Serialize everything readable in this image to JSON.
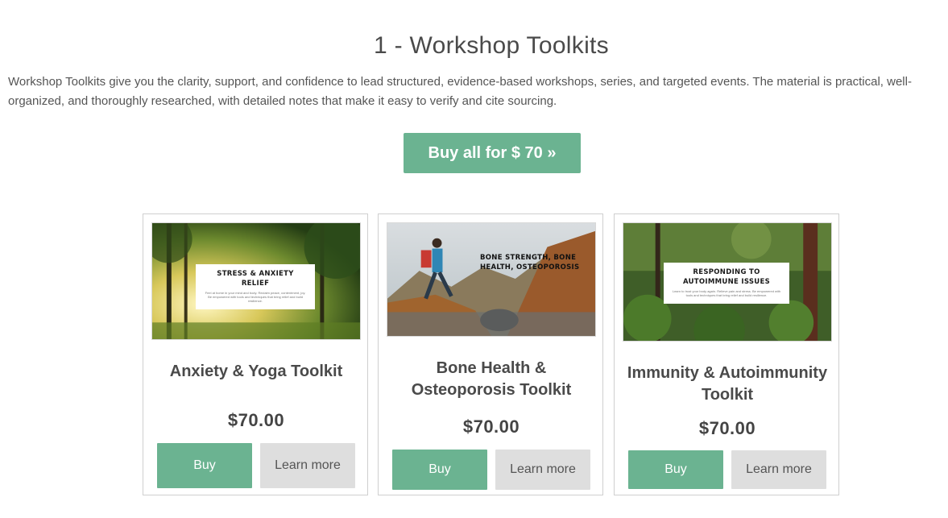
{
  "header": {
    "title": "1 - Workshop Toolkits",
    "intro": "Workshop Toolkits give you the clarity, support, and confidence to lead structured, evidence-based workshops, series, and targeted events. The material is practical, well-organized, and thoroughly researched, with detailed notes that make it easy to verify and cite sourcing."
  },
  "buy_all_label": "Buy all for $ 70 »",
  "products": [
    {
      "banner_title": "STRESS & ANXIETY RELIEF",
      "banner_sub": "Feel at home in your mind and body. Reclaim peace, contentment, joy. Be empowered with tools and techniques that bring relief and build resilience.",
      "name": "Anxiety & Yoga Toolkit",
      "price": "$70.00",
      "buy_label": "Buy",
      "learn_label": "Learn more"
    },
    {
      "banner_title": "BONE STRENGTH, BONE HEALTH, OSTEOPOROSIS",
      "banner_sub": "",
      "name": "Bone Health & Osteoporosis Toolkit",
      "price": "$70.00",
      "buy_label": "Buy",
      "learn_label": "Learn more"
    },
    {
      "banner_title": "RESPONDING TO AUTOIMMUNE ISSUES",
      "banner_sub": "Learn to trust your body again. Relieve pain and stress. Be empowered with tools and techniques that bring relief and build resilience.",
      "name": "Immunity & Autoimmunity Toolkit",
      "price": "$70.00",
      "buy_label": "Buy",
      "learn_label": "Learn more"
    }
  ],
  "colors": {
    "accent": "#6bb391",
    "secondary_button": "#dedede"
  }
}
